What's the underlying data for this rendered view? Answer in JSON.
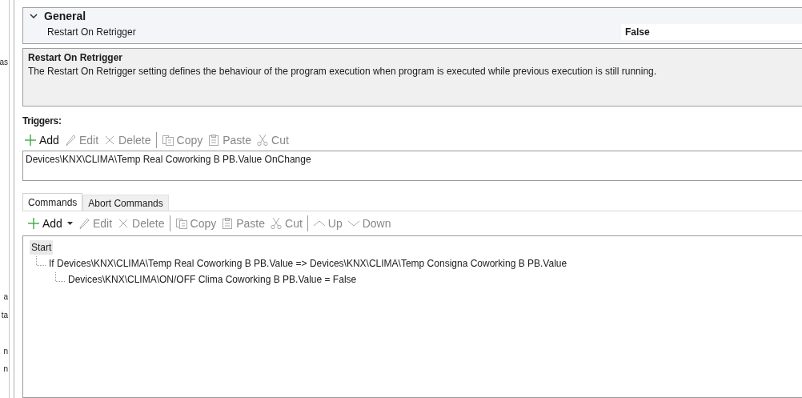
{
  "left_panel_fragments": [
    {
      "text": "as"
    },
    {
      "text": "a"
    },
    {
      "text": "ta"
    },
    {
      "text": "n"
    },
    {
      "text": "n"
    }
  ],
  "property_grid": {
    "category": {
      "label": "General",
      "expanded": true
    },
    "rows": [
      {
        "name": "Restart On Retrigger",
        "value": "False"
      }
    ]
  },
  "description": {
    "title": "Restart On Retrigger",
    "text": "The Restart On Retrigger setting defines the behaviour of the program execution when program is executed while previous execution is still running."
  },
  "triggers": {
    "label": "Triggers:",
    "toolbar": [
      {
        "kind": "add",
        "label": "Add",
        "disabled": false
      },
      {
        "kind": "edit",
        "label": "Edit",
        "disabled": true
      },
      {
        "kind": "delete",
        "label": "Delete",
        "disabled": true
      },
      {
        "kind": "separator"
      },
      {
        "kind": "copy",
        "label": "Copy",
        "disabled": true
      },
      {
        "kind": "paste",
        "label": "Paste",
        "disabled": true
      },
      {
        "kind": "cut",
        "label": "Cut",
        "disabled": true
      }
    ],
    "items": [
      "Devices\\KNX\\CLIMA\\Temp Real Coworking B PB.Value OnChange"
    ]
  },
  "tabs": [
    {
      "label": "Commands",
      "selected": true
    },
    {
      "label": "Abort Commands",
      "selected": false
    }
  ],
  "commands": {
    "toolbar": [
      {
        "kind": "addmenu",
        "label": "Add",
        "disabled": false
      },
      {
        "kind": "edit",
        "label": "Edit",
        "disabled": true
      },
      {
        "kind": "delete",
        "label": "Delete",
        "disabled": true
      },
      {
        "kind": "separator"
      },
      {
        "kind": "copy",
        "label": "Copy",
        "disabled": true
      },
      {
        "kind": "paste",
        "label": "Paste",
        "disabled": true
      },
      {
        "kind": "cut",
        "label": "Cut",
        "disabled": true
      },
      {
        "kind": "separator"
      },
      {
        "kind": "up",
        "label": "Up",
        "disabled": true
      },
      {
        "kind": "down",
        "label": "Down",
        "disabled": true
      }
    ],
    "tree": [
      {
        "label": "Start",
        "selected": true,
        "children": [
          {
            "label": "If Devices\\KNX\\CLIMA\\Temp Real Coworking B PB.Value => Devices\\KNX\\CLIMA\\Temp Consigna Coworking B PB.Value",
            "selected": false,
            "children": [
              {
                "label": "Devices\\KNX\\CLIMA\\ON/OFF Clima Coworking B PB.Value = False",
                "selected": false
              }
            ]
          }
        ]
      }
    ]
  }
}
